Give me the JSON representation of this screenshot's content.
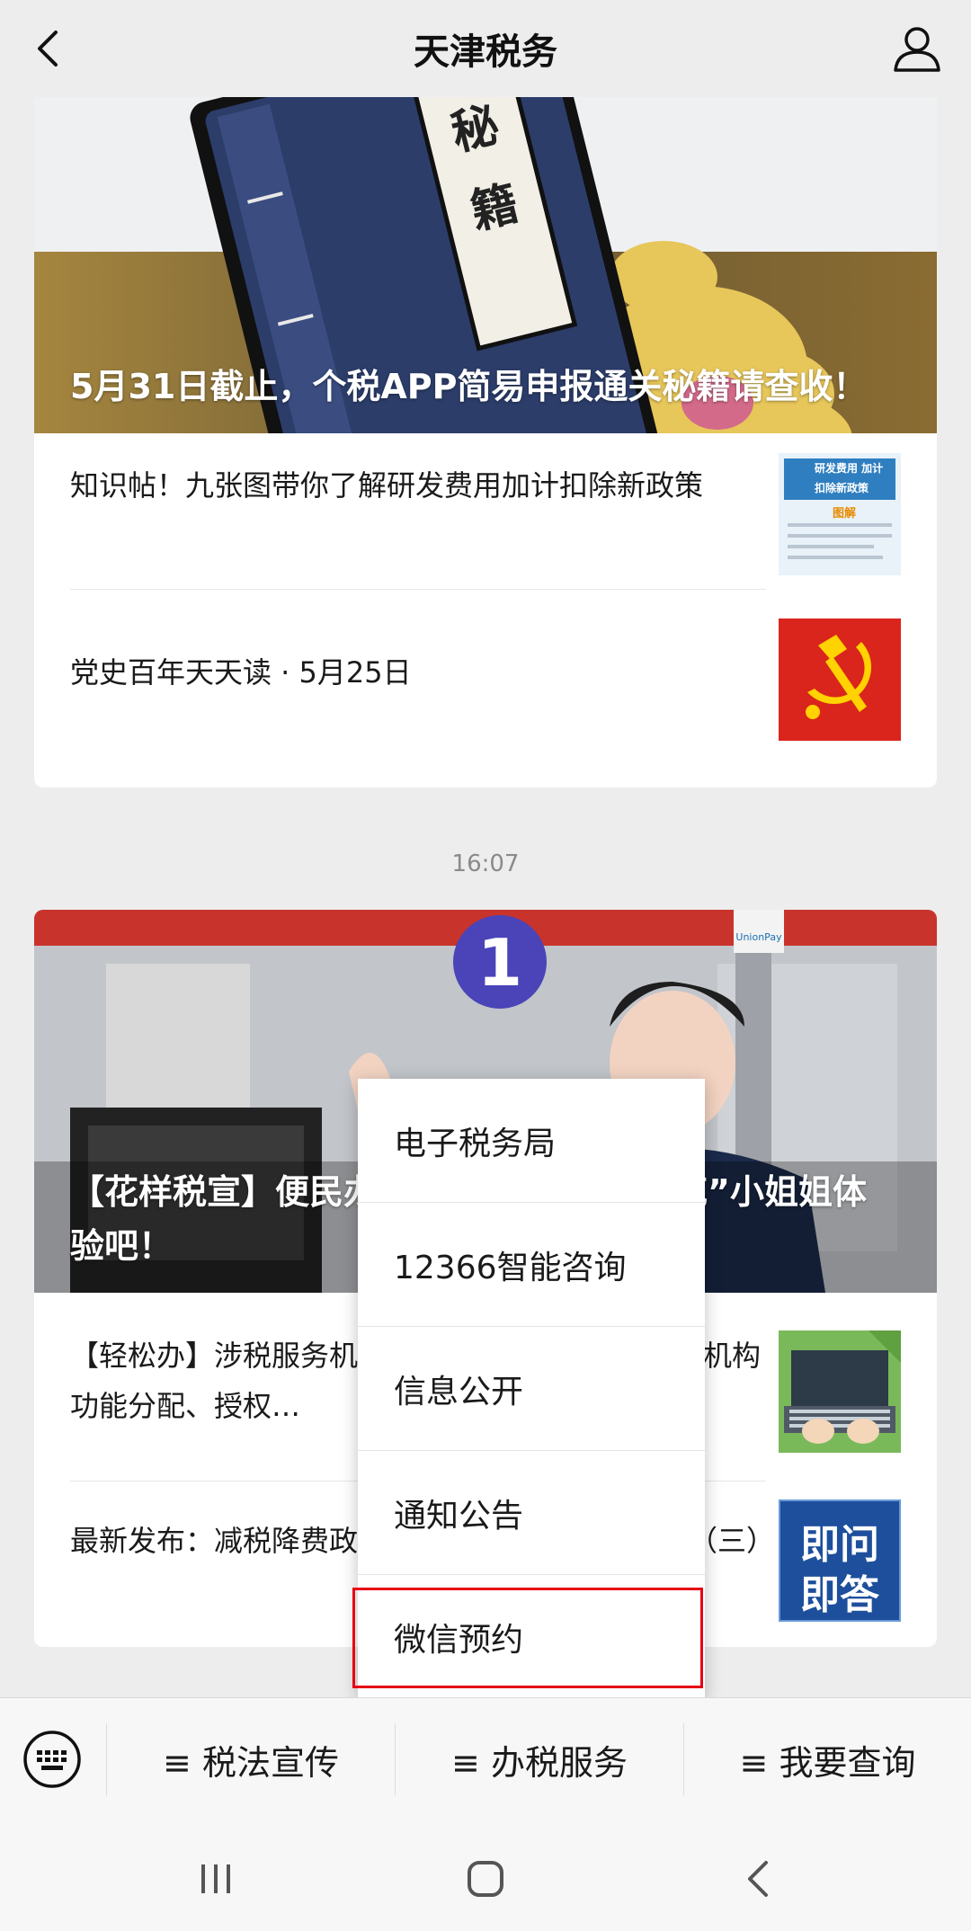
{
  "header": {
    "title": "天津税务"
  },
  "article_group_1": {
    "banner_title": "5月31日截止，个税APP简易申报通关秘籍请查收！",
    "banner_book_chars": [
      "秘",
      "籍"
    ],
    "items": [
      {
        "text": "知识帖！九张图带你了解研发费用加计扣除新政策",
        "thumb_caption": "研发费用 加计扣除新政策",
        "thumb_tag": "图解"
      },
      {
        "text": "党史百年天天读 · 5月25日"
      }
    ]
  },
  "timestamp": "16:07",
  "article_group_2": {
    "banner_title": "【花样税宣】便民办税新举措，跟着“税花”小姐姐体验吧！",
    "banner_badge": "1",
    "banner_logo_text": "UnionPay",
    "items": [
      {
        "text": "【轻松办】涉税服务机构如何进行办税人员、涉税机构功能分配、授权…"
      },
      {
        "text": "最新发布：减税降费政策操作指南汇编（第二期）（三）",
        "thumb_text_top": "即问",
        "thumb_text_bottom": "即答"
      }
    ]
  },
  "popup_menu": {
    "items": [
      "电子税务局",
      "12366智能咨询",
      "信息公开",
      "通知公告",
      "微信预约"
    ],
    "highlighted_index": 4,
    "highlight_color": "#e60012"
  },
  "bottom_menu": {
    "tabs": [
      "≡ 税法宣传",
      "≡ 办税服务",
      "≡ 我要查询"
    ]
  },
  "colors": {
    "background": "#ededed",
    "card": "#ffffff",
    "party_red": "#d9251c",
    "party_gold": "#ffd200",
    "qa_blue": "#1d4f9c"
  }
}
